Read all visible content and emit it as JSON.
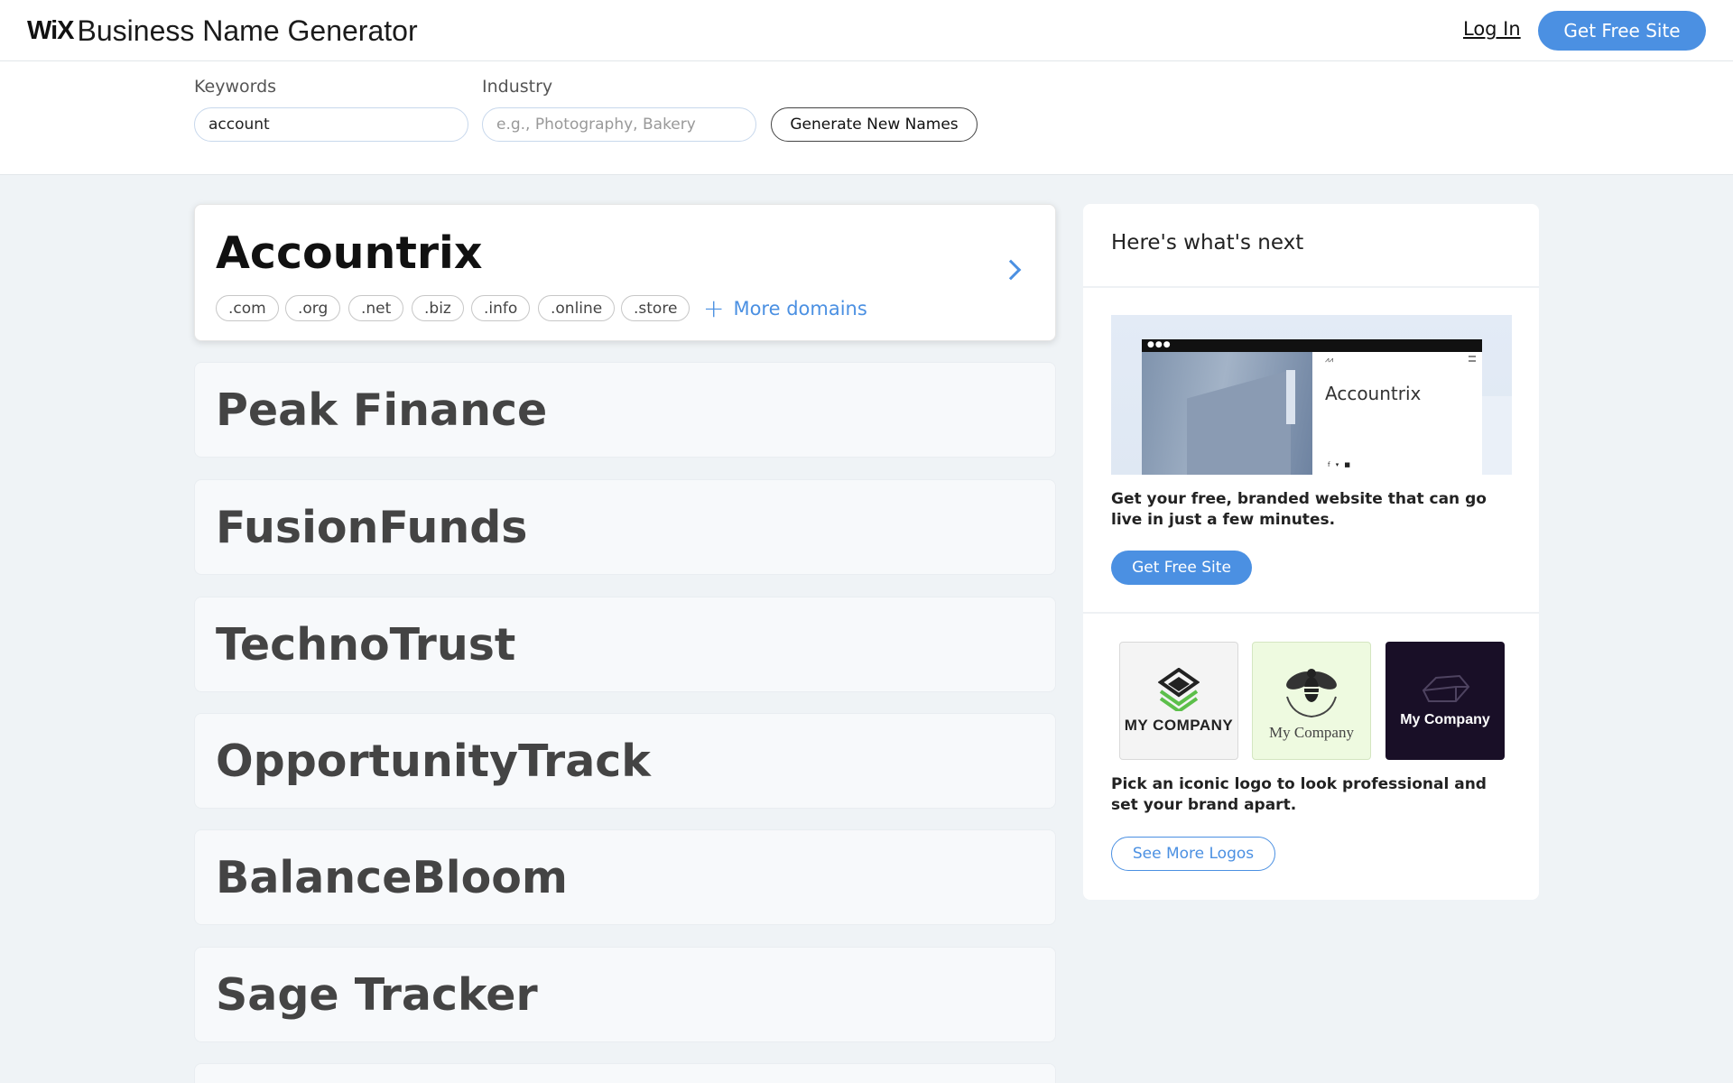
{
  "header": {
    "logo": "WiX",
    "title": "Business Name Generator",
    "login_label": "Log In",
    "cta_label": "Get Free Site"
  },
  "search": {
    "keywords_label": "Keywords",
    "keywords_value": "account",
    "industry_label": "Industry",
    "industry_placeholder": "e.g., Photography, Bakery",
    "generate_label": "Generate New Names"
  },
  "results": {
    "selected": {
      "name": "Accountrix",
      "domains": [
        ".com",
        ".org",
        ".net",
        ".biz",
        ".info",
        ".online",
        ".store"
      ],
      "more_domains_label": "More domains"
    },
    "names": [
      "Peak Finance",
      "FusionFunds",
      "TechnoTrust",
      "OpportunityTrack",
      "BalanceBloom",
      "Sage Tracker"
    ]
  },
  "next_panel": {
    "title": "Here's what's next",
    "preview_site_name": "Accountrix",
    "website_text": "Get your free, branded website that can go live in just a few minutes.",
    "website_button": "Get Free Site",
    "logo_samples": [
      "MY COMPANY",
      "My Company",
      "My Company"
    ],
    "logo_text": "Pick an iconic logo to look professional and set your brand apart.",
    "logo_button": "See More Logos"
  },
  "colors": {
    "accent": "#4b90e2",
    "page_bg": "#eff3f6",
    "card_bg": "#f7f9fb",
    "logo_dark_bg": "#190f27",
    "logo_green_bg": "#eefae0"
  }
}
